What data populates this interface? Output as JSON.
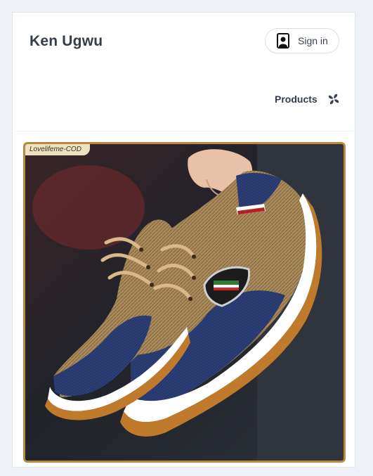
{
  "header": {
    "brand": "Ken Ugwu",
    "signin_label": "Sign in",
    "signin_icon": "user-portrait-icon",
    "nav_products_label": "Products",
    "nav_products_icon": "fan-icon"
  },
  "product": {
    "image_watermark": "Lovelifeme-COD"
  },
  "colors": {
    "page_bg": "#eef1f7",
    "card_bg": "#ffffff",
    "text_dark": "#343d4b",
    "image_frame": "#b9893f"
  }
}
